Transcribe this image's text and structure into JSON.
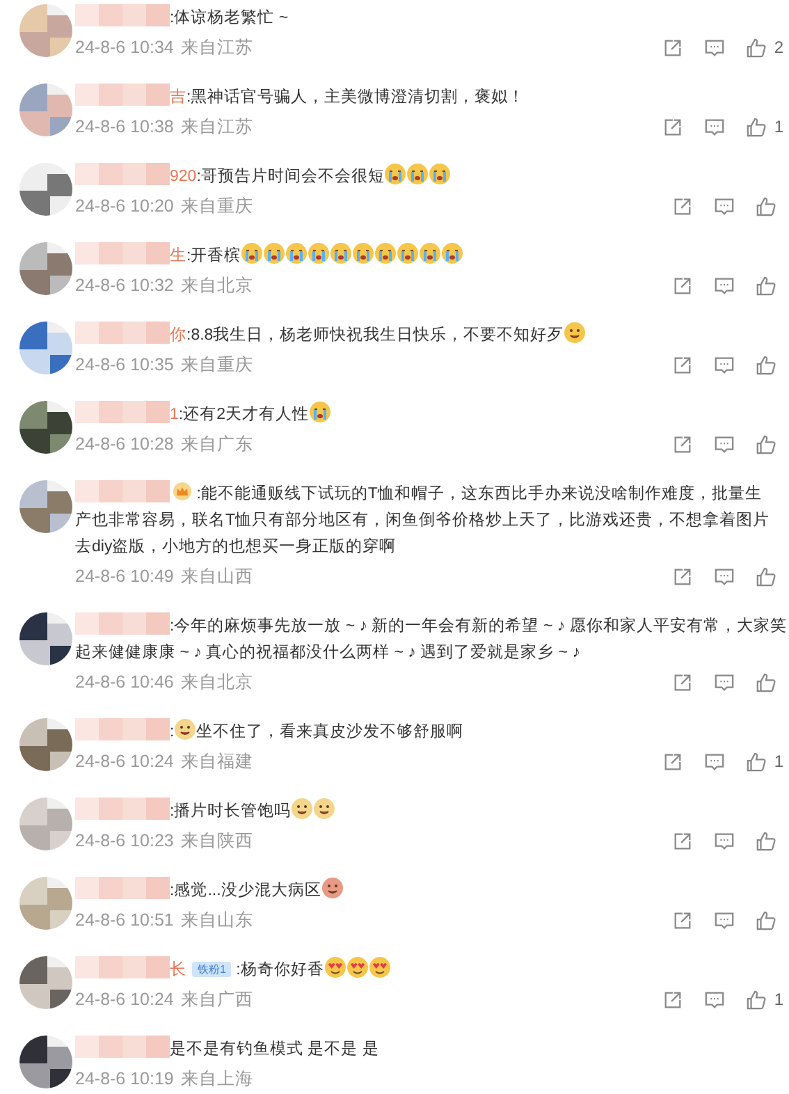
{
  "comments": [
    {
      "parts": [
        {
          "kind": "text",
          "text": ":体谅杨老繁忙 ~"
        }
      ],
      "time": "24-8-6 10:34",
      "location": "来自江苏",
      "likes": "2"
    },
    {
      "name_fragment": "吉",
      "parts": [
        {
          "kind": "text",
          "text": ":黑神话官号骗人，主美微博澄清切割，褒姒！"
        }
      ],
      "time": "24-8-6 10:38",
      "location": "来自江苏",
      "likes": "1"
    },
    {
      "name_fragment": "920",
      "parts": [
        {
          "kind": "text",
          "text": ":哥预告片时间会不会很短"
        },
        {
          "kind": "cry_emoji"
        },
        {
          "kind": "cry_emoji"
        },
        {
          "kind": "cry_emoji"
        }
      ],
      "time": "24-8-6 10:20",
      "location": "来自重庆"
    },
    {
      "name_fragment": "生",
      "parts": [
        {
          "kind": "text",
          "text": ":开香槟"
        },
        {
          "kind": "wail_emoji"
        },
        {
          "kind": "wail_emoji"
        },
        {
          "kind": "wail_emoji"
        },
        {
          "kind": "wail_emoji"
        },
        {
          "kind": "wail_emoji"
        },
        {
          "kind": "wail_emoji"
        },
        {
          "kind": "wail_emoji"
        },
        {
          "kind": "wail_emoji"
        },
        {
          "kind": "wail_emoji"
        },
        {
          "kind": "wail_emoji"
        }
      ],
      "time": "24-8-6 10:32",
      "location": "来自北京"
    },
    {
      "name_fragment": "你",
      "parts": [
        {
          "kind": "text",
          "text": ":8.8我生日，杨老师快祝我生日快乐，不要不知好歹"
        },
        {
          "kind": "grin_emoji"
        }
      ],
      "time": "24-8-6 10:35",
      "location": "来自重庆"
    },
    {
      "name_fragment": "1",
      "parts": [
        {
          "kind": "text",
          "text": ":还有2天才有人性"
        },
        {
          "kind": "cry_emoji"
        }
      ],
      "time": "24-8-6 10:28",
      "location": "来自广东"
    },
    {
      "crown_badge": true,
      "parts": [
        {
          "kind": "text",
          "text": " :能不能通贩线下试玩的T恤和帽子，这东西比手办来说没啥制作难度，批量生"
        },
        {
          "kind": "break"
        },
        {
          "kind": "text",
          "text": "产也非常容易，联名T恤只有部分地区有，闲鱼倒爷价格炒上天了，比游戏还贵，不想拿着图片"
        },
        {
          "kind": "break"
        },
        {
          "kind": "text",
          "text": "去diy盗版，小地方的也想买一身正版的穿啊"
        }
      ],
      "time": "24-8-6 10:49",
      "location": "来自山西"
    },
    {
      "parts": [
        {
          "kind": "text",
          "text": ":今年的麻烦事先放一放 ~ ♪  新的一年会有新的希望 ~ ♪  愿你和家人平安有常，大家笑"
        },
        {
          "kind": "break"
        },
        {
          "kind": "text",
          "text": "起来健健康康 ~ ♪  真心的祝福都没什么两样 ~ ♪  遇到了爱就是家乡 ~ ♪"
        }
      ],
      "time": "24-8-6 10:46",
      "location": "来自北京"
    },
    {
      "parts": [
        {
          "kind": "text",
          "text": ":"
        },
        {
          "kind": "dog_emoji"
        },
        {
          "kind": "text",
          "text": "坐不住了，看来真皮沙发不够舒服啊"
        }
      ],
      "time": "24-8-6 10:24",
      "location": "来自福建",
      "likes": "1"
    },
    {
      "parts": [
        {
          "kind": "text",
          "text": ":播片时长管饱吗"
        },
        {
          "kind": "dog_emoji"
        },
        {
          "kind": "dog_emoji"
        }
      ],
      "time": "24-8-6 10:23",
      "location": "来自陕西"
    },
    {
      "parts": [
        {
          "kind": "text",
          "text": ":感觉...没少混大病区"
        },
        {
          "kind": "pig_emoji"
        }
      ],
      "time": "24-8-6 10:51",
      "location": "来自山东"
    },
    {
      "name_fragment": "长",
      "fan_badge": "铁粉1",
      "parts": [
        {
          "kind": "text",
          "text": " :杨奇你好香"
        },
        {
          "kind": "heart_eyes_emoji"
        },
        {
          "kind": "heart_eyes_emoji"
        },
        {
          "kind": "heart_eyes_emoji"
        }
      ],
      "time": "24-8-6 10:24",
      "location": "来自广西",
      "likes": "1"
    },
    {
      "parts": [
        {
          "kind": "text",
          "text": "是不是有钓鱼模式 是不是 是"
        }
      ],
      "time": "24-8-6 10:19",
      "location": "来自上海",
      "actions_hidden": true
    }
  ]
}
